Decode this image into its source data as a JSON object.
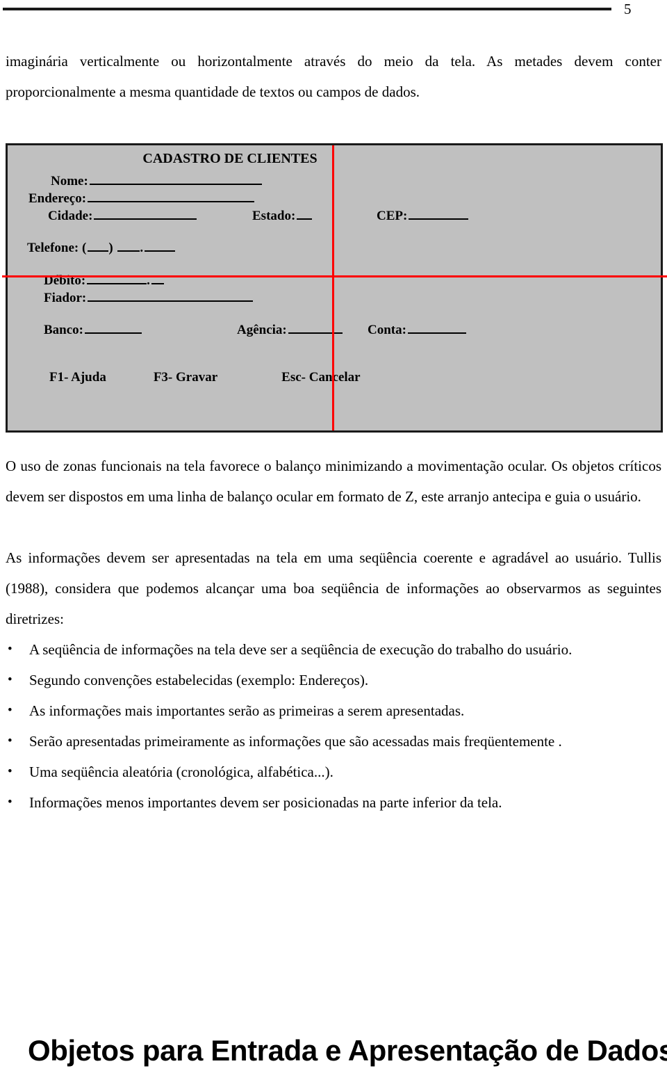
{
  "header": {
    "page_number": "5",
    "rule": "horizontal-rule"
  },
  "top_paragraph": {
    "text": "imaginária verticalmente ou horizontalmente através do meio da tela. As metades devem conter proporcionalmente a mesma quantidade de textos ou campos de dados."
  },
  "form_mock": {
    "title": "CADASTRO DE CLIENTES",
    "background_color": "#c0c0c0",
    "border_color": "#1a1a1a",
    "guide_color": "#ff0000",
    "fields": {
      "nome": "Nome:",
      "endereco": "Endereço:",
      "cidade": "Cidade:",
      "estado": "Estado:",
      "cep": "CEP:",
      "telefone": "Telefone:",
      "telefone_open_paren": "(",
      "telefone_close_paren": ")",
      "telefone_separator": ".",
      "debito": "Débito:",
      "debito_separator": ".",
      "fiador": "Fiador:",
      "banco": "Banco:",
      "agencia": "Agência:",
      "conta": "Conta:"
    },
    "function_keys": [
      "F1- Ajuda",
      "F3- Gravar",
      "Esc- Cancelar"
    ]
  },
  "paragraphs": [
    "O uso de zonas funcionais na tela favorece o balanço minimizando a movimentação ocular. Os objetos críticos devem ser dispostos em uma linha de balanço ocular em formato de Z, este arranjo antecipa e guia o usuário.",
    "As informações devem ser apresentadas na tela em uma seqüência coerente e agradável ao usuário. Tullis (1988), considera que podemos alcançar uma boa seqüência de informações ao observarmos as seguintes diretrizes:"
  ],
  "bullets": [
    "A seqüência de informações na tela deve ser a seqüência de execução do trabalho do usuário.",
    "Segundo convenções estabelecidas (exemplo: Endereços).",
    "As informações mais importantes serão as primeiras a serem apresentadas.",
    "Serão apresentadas primeiramente as informações que são acessadas mais freqüentemente .",
    "Uma seqüência aleatória (cronológica, alfabética...).",
    "Informações menos importantes devem ser posicionadas na parte inferior da tela."
  ],
  "bullet_glyph": "•",
  "bottom_title": "Objetos para Entrada e Apresentação de Dados"
}
